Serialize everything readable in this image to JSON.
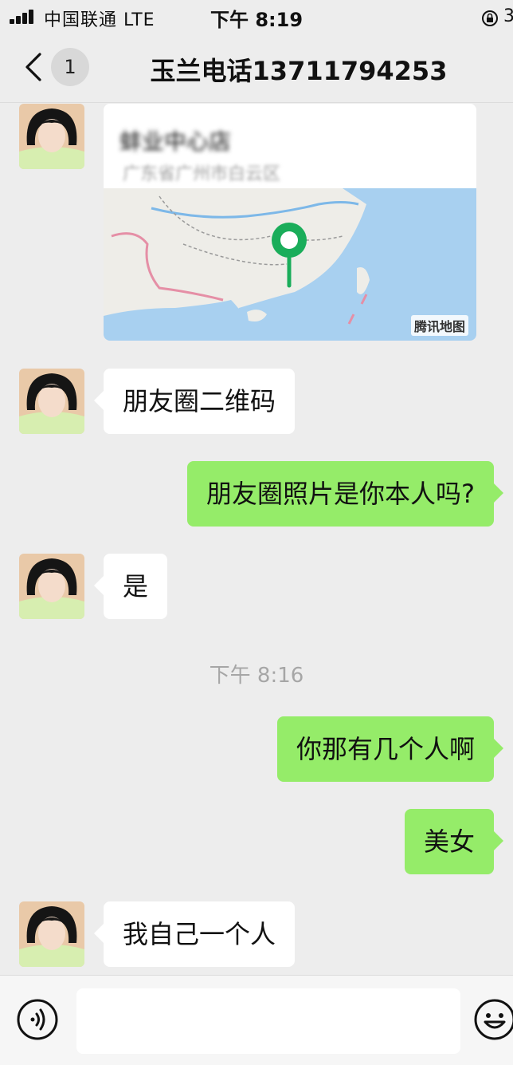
{
  "status_bar": {
    "carrier": "中国联通",
    "network": "LTE",
    "time": "下午 8:19",
    "battery": "3"
  },
  "nav": {
    "unread_count": "1",
    "title": "玉兰电话13711794253"
  },
  "location_card": {
    "place_name": "蚌业中心店",
    "address": "广东省广州市白云区",
    "map_provider": "腾讯地图"
  },
  "messages": [
    {
      "side": "in",
      "text": "朋友圈二维码"
    },
    {
      "side": "out",
      "text": "朋友圈照片是你本人吗?"
    },
    {
      "side": "in",
      "text": "是"
    },
    {
      "side": "out",
      "text": "你那有几个人啊"
    },
    {
      "side": "out",
      "text": "美女"
    },
    {
      "side": "in",
      "text": "我自己一个人"
    }
  ],
  "timestamp": "下午 8:16",
  "input_bar": {
    "placeholder": ""
  },
  "colors": {
    "background": "#ededed",
    "outgoing_bubble": "#95ec69",
    "incoming_bubble": "#ffffff",
    "map_pin": "#1aad5a"
  }
}
